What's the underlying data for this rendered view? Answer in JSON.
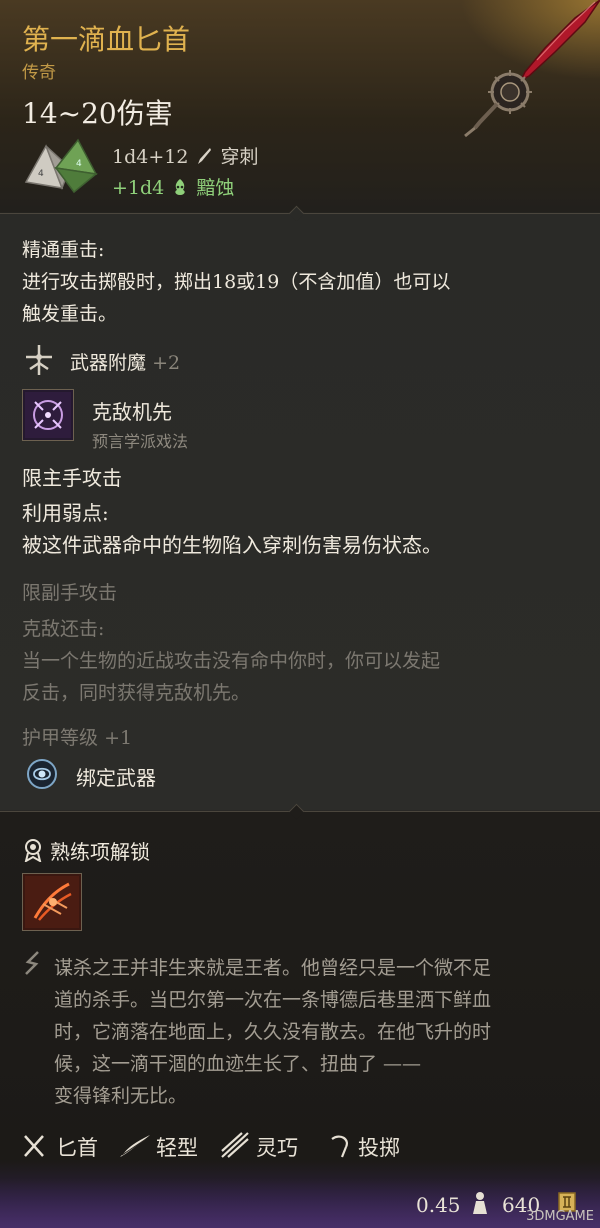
{
  "item": {
    "name": "第一滴血匕首",
    "rarity": "传奇",
    "damage": "14~20伤害",
    "dice": "1d4+12",
    "damage_type": "穿刺",
    "bonus_dice": "+1d4",
    "bonus_type": "黯蚀"
  },
  "passives": {
    "crit_title": "精通重击:",
    "crit_line1": "进行攻击掷骰时，掷出18或19（不含加值）也可以",
    "crit_line2": "触发重击。"
  },
  "enchant": {
    "label": "武器附魔",
    "value": "+2"
  },
  "spell": {
    "name": "克敌机先",
    "school": "预言学派戏法"
  },
  "main_hand": {
    "heading": "限主手攻击",
    "feature_title": "利用弱点:",
    "feature_desc": "被这件武器命中的生物陷入穿刺伤害易伤状态。"
  },
  "off_hand": {
    "heading": "限副手攻击",
    "feature_title": "克敌还击:",
    "line1": "当一个生物的近战攻击没有命中你时，你可以发起",
    "line2": "反击，同时获得克敌机先。"
  },
  "armor_class": {
    "label": "护甲等级",
    "value": "+1"
  },
  "bind": {
    "label": "绑定武器"
  },
  "proficiency": {
    "label": "熟练项解锁"
  },
  "lore": {
    "line1": "谋杀之王并非生来就是王者。他曾经只是一个微不足",
    "line2": "道的杀手。当巴尔第一次在一条博德后巷里洒下鲜血",
    "line3": "时，它滴落在地面上，久久没有散去。在他飞升的时",
    "line4": "候，这一滴干涸的血迹生长了、扭曲了 ——",
    "line5": "变得锋利无比。"
  },
  "tags": [
    "匕首",
    "轻型",
    "灵巧",
    "投掷"
  ],
  "footer": {
    "weight": "0.45",
    "price": "640"
  },
  "watermark": "3DMGAME",
  "colors": {
    "title_gold": "#e0b24f",
    "bonus_green": "#8fd07a",
    "blood_red": "#b0182a"
  }
}
